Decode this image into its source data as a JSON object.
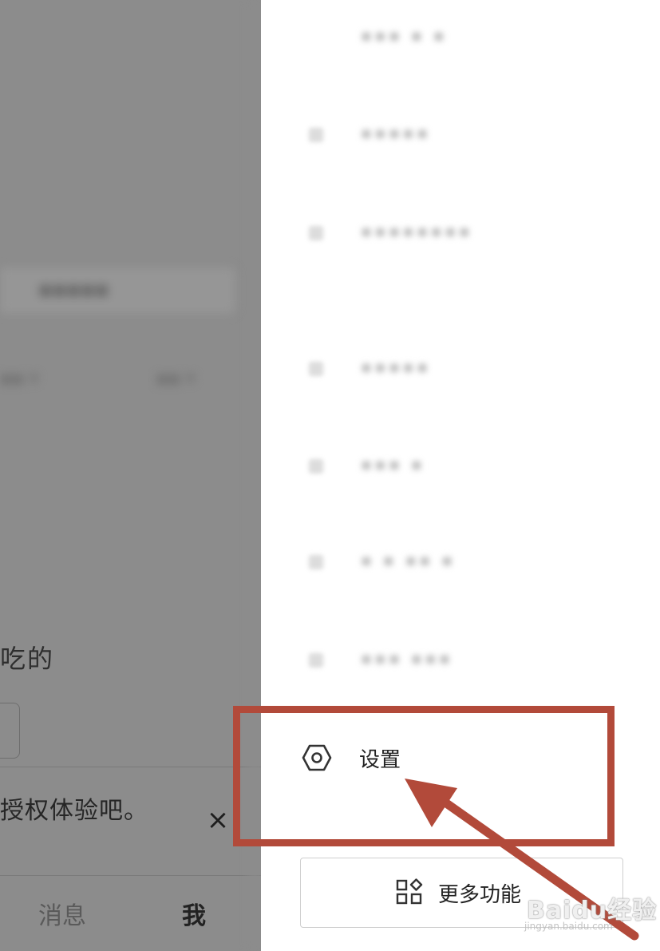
{
  "background_app": {
    "eat_text": "吃的",
    "auth_text": "授权体验吧。",
    "close_symbol": "×",
    "tabs": [
      {
        "label": "消息"
      },
      {
        "label": "我"
      }
    ]
  },
  "drawer": {
    "settings_label": "设置",
    "more_features_label": "更多功能"
  },
  "annotation": {
    "color": "#b24a3a"
  },
  "watermark": {
    "brand": "Baidu经验",
    "url": "jingyan.baidu.com"
  },
  "icons": {
    "settings": "hexagon-gear-icon",
    "more_features": "grid-apps-icon",
    "close": "close-icon"
  }
}
